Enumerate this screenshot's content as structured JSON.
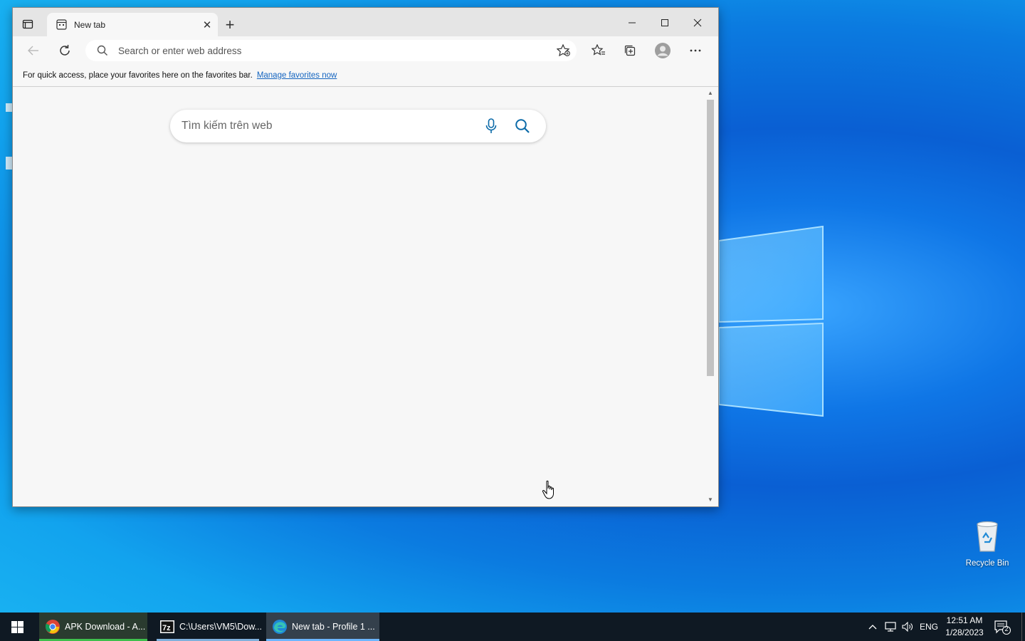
{
  "browser": {
    "tab_title": "New tab",
    "address_placeholder": "Search or enter web address",
    "favorites_bar": {
      "message": "For quick access, place your favorites here on the favorites bar.",
      "link": "Manage favorites now"
    },
    "web_search_placeholder": "Tìm kiếm trên web"
  },
  "desktop": {
    "recycle_bin_label": "Recycle Bin"
  },
  "taskbar": {
    "items": [
      {
        "label": "APK Download - A...",
        "icon": "chrome-icon"
      },
      {
        "label": "C:\\Users\\VM5\\Dow...",
        "icon": "7zip-icon"
      },
      {
        "label": "New tab - Profile 1 ...",
        "icon": "edge-icon"
      }
    ],
    "language": "ENG",
    "time": "12:51 AM",
    "date": "1/28/2023",
    "notification_count": "2"
  },
  "colors": {
    "taskbar_bg": "#0f1923",
    "accent_link": "#1565c0",
    "chrome_underline": "#3fbf4d",
    "active_underline": "#6cb6ff"
  }
}
